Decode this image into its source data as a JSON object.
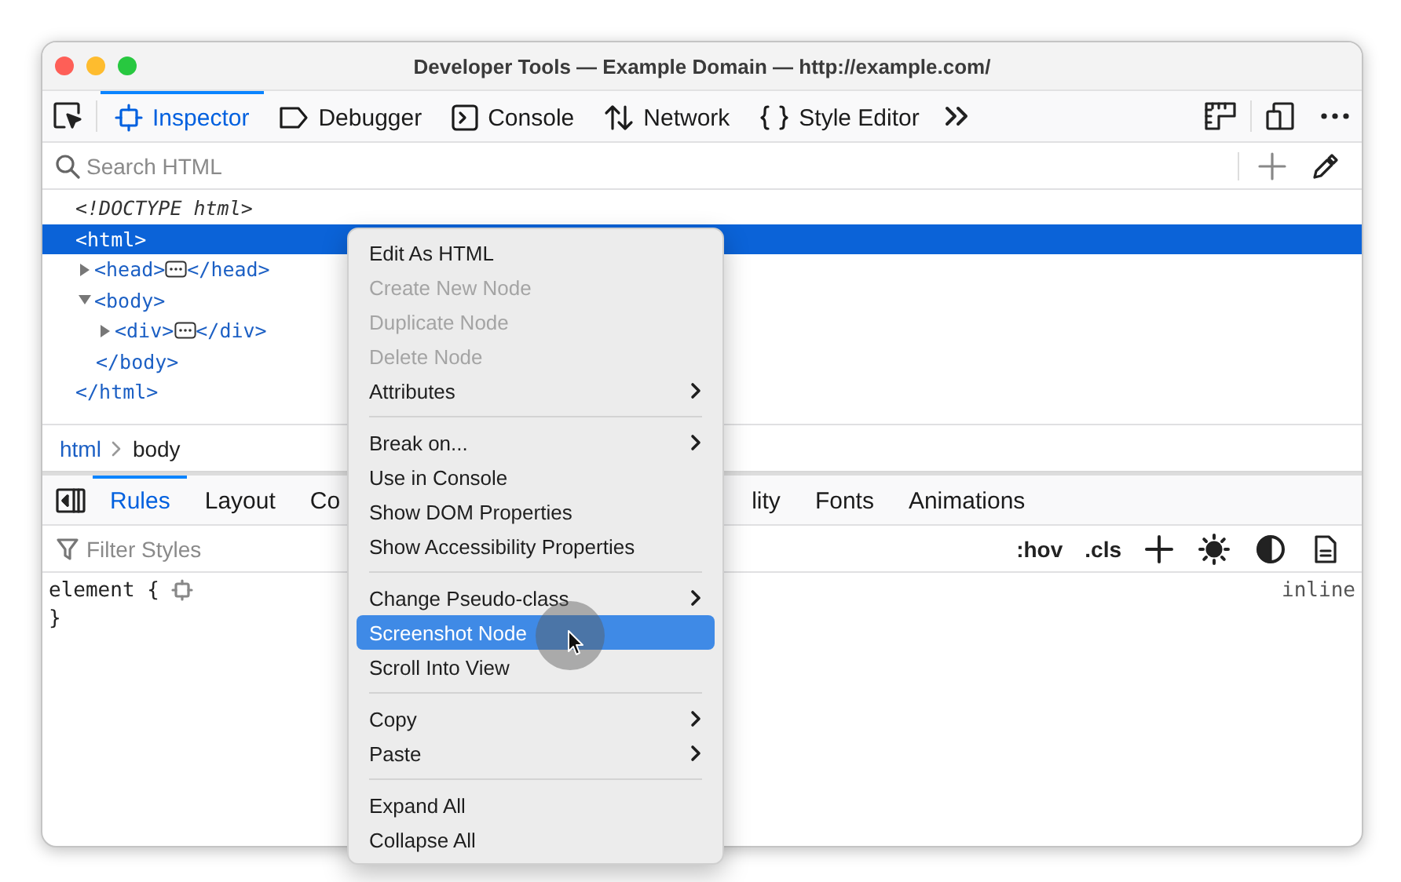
{
  "window": {
    "title": "Developer Tools — Example Domain — http://example.com/"
  },
  "toolbar": {
    "tabs": [
      {
        "label": "Inspector",
        "selected": true
      },
      {
        "label": "Debugger",
        "selected": false
      },
      {
        "label": "Console",
        "selected": false
      },
      {
        "label": "Network",
        "selected": false
      },
      {
        "label": "Style Editor",
        "selected": false
      }
    ]
  },
  "search": {
    "placeholder": "Search HTML"
  },
  "markup": {
    "nodes": [
      {
        "kind": "doctype",
        "text": "<!DOCTYPE html>",
        "selected": false
      },
      {
        "kind": "element",
        "open": "<html>",
        "close": "</html>",
        "selected": true,
        "children": [
          {
            "kind": "element",
            "open": "<head>",
            "close": "</head>",
            "expanded": false,
            "selected": false
          },
          {
            "kind": "element",
            "open": "<body>",
            "close": "</body>",
            "expanded": true,
            "selected": false,
            "children": [
              {
                "kind": "element",
                "open": "<div>",
                "close": "</div>",
                "expanded": false,
                "selected": false
              }
            ]
          }
        ]
      }
    ]
  },
  "breadcrumbs": [
    {
      "label": "html",
      "selected": true
    },
    {
      "label": "body",
      "selected": false
    }
  ],
  "sidebar": {
    "tabs": [
      {
        "label": "Rules",
        "selected": true
      },
      {
        "label": "Layout",
        "selected": false
      },
      {
        "label": "Co",
        "selected": false
      },
      {
        "label": "lity",
        "selected": false
      },
      {
        "label": "Fonts",
        "selected": false
      },
      {
        "label": "Animations",
        "selected": false
      }
    ],
    "filter": {
      "placeholder": "Filter Styles"
    },
    "toggles": [
      ":hov",
      ".cls"
    ],
    "rule": {
      "open": "element {",
      "close": "}",
      "source": "inline"
    }
  },
  "context_menu": {
    "items": [
      {
        "kind": "item",
        "label": "Edit As HTML",
        "disabled": false,
        "submenu": false,
        "selected": false
      },
      {
        "kind": "item",
        "label": "Create New Node",
        "disabled": true,
        "submenu": false,
        "selected": false
      },
      {
        "kind": "item",
        "label": "Duplicate Node",
        "disabled": true,
        "submenu": false,
        "selected": false
      },
      {
        "kind": "item",
        "label": "Delete Node",
        "disabled": true,
        "submenu": false,
        "selected": false
      },
      {
        "kind": "item",
        "label": "Attributes",
        "disabled": false,
        "submenu": true,
        "selected": false
      },
      {
        "kind": "separator"
      },
      {
        "kind": "item",
        "label": "Break on...",
        "disabled": false,
        "submenu": true,
        "selected": false
      },
      {
        "kind": "item",
        "label": "Use in Console",
        "disabled": false,
        "submenu": false,
        "selected": false
      },
      {
        "kind": "item",
        "label": "Show DOM Properties",
        "disabled": false,
        "submenu": false,
        "selected": false
      },
      {
        "kind": "item",
        "label": "Show Accessibility Properties",
        "disabled": false,
        "submenu": false,
        "selected": false
      },
      {
        "kind": "separator"
      },
      {
        "kind": "item",
        "label": "Change Pseudo-class",
        "disabled": false,
        "submenu": true,
        "selected": false
      },
      {
        "kind": "item",
        "label": "Screenshot Node",
        "disabled": false,
        "submenu": false,
        "selected": true
      },
      {
        "kind": "item",
        "label": "Scroll Into View",
        "disabled": false,
        "submenu": false,
        "selected": false
      },
      {
        "kind": "separator"
      },
      {
        "kind": "item",
        "label": "Copy",
        "disabled": false,
        "submenu": true,
        "selected": false
      },
      {
        "kind": "item",
        "label": "Paste",
        "disabled": false,
        "submenu": true,
        "selected": false
      },
      {
        "kind": "separator"
      },
      {
        "kind": "item",
        "label": "Expand All",
        "disabled": false,
        "submenu": false,
        "selected": false
      },
      {
        "kind": "item",
        "label": "Collapse All",
        "disabled": false,
        "submenu": false,
        "selected": false
      }
    ]
  }
}
